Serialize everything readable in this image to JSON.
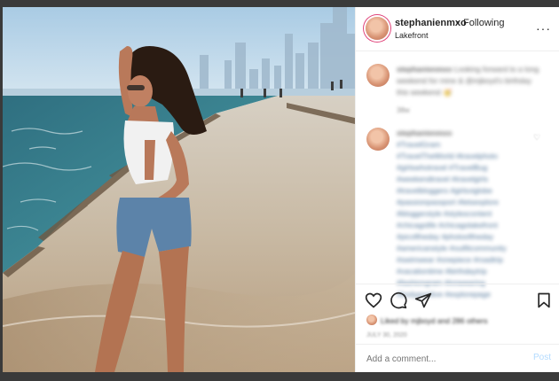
{
  "post": {
    "username": "stephanienmxo",
    "dot": "•",
    "follow_status": "Following",
    "location": "Lakefront",
    "more_icon": "more-options-icon",
    "more_glyph": "···"
  },
  "caption": {
    "username": "stephanienmxo",
    "text": "Looking forward to a long weekend for mine & @mjboyd's birthday this weekend 🥳",
    "time": "38w"
  },
  "hashtags": {
    "username": "stephanienmxo",
    "lines": [
      "#TravelGram",
      "#TravelTheWorld #travelphoto",
      "#girlswhotravel #TravelBug",
      "#weekendtravel #travelgirls",
      "#travelbloggers #girlsviglobe",
      "#passionpassport #letsexplore",
      "#bloggerstyle #stylescontent",
      "#chicagolife #chicagolakefront",
      "#picoftheday #photooftheday",
      "#americanstyle #outfitcommunity",
      "#swimwear #onepiece #roadtrip",
      "#vacationtime #birthdaytrip",
      "#fashiongram #innwearing",
      "#bodypositive #explorepage"
    ]
  },
  "likes": {
    "text": "Liked by mjboyd and 286 others"
  },
  "date": "JULY 30, 2020",
  "comment_box": {
    "placeholder": "Add a comment...",
    "post_label": "Post"
  },
  "colors": {
    "accent_link": "#00376b",
    "post_button": "#b3dbff",
    "story_ring": "#e0457b"
  }
}
